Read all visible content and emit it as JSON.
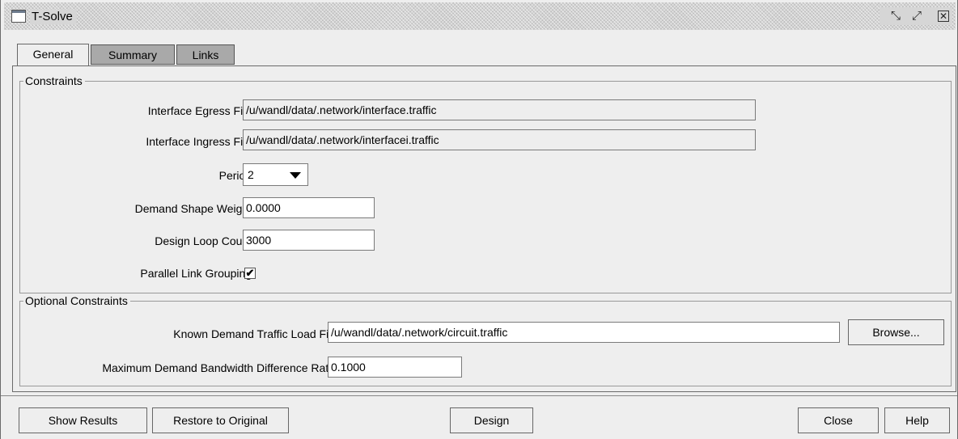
{
  "window": {
    "title": "T-Solve",
    "icon": "window-icon",
    "minimize_icon": "minimize-icon",
    "maximize_icon": "maximize-icon",
    "close_icon": "close-icon"
  },
  "tabs": [
    {
      "label": "General",
      "active": true
    },
    {
      "label": "Summary",
      "active": false
    },
    {
      "label": "Links",
      "active": false
    }
  ],
  "constraints": {
    "title": "Constraints",
    "egress_label": "Interface Egress File:",
    "egress_value": "/u/wandl/data/.network/interface.traffic",
    "ingress_label": "Interface Ingress File:",
    "ingress_value": "/u/wandl/data/.network/interfacei.traffic",
    "period_label": "Period:",
    "period_value": "2",
    "shape_weight_label": "Demand Shape Weight:",
    "shape_weight_value": "0.0000",
    "loop_count_label": "Design Loop Count:",
    "loop_count_value": "3000",
    "parallel_label": "Parallel Link Grouping:",
    "parallel_checked": true,
    "check_mark": "✔"
  },
  "optional": {
    "title": "Optional Constraints",
    "load_file_label": "Known Demand Traffic Load File:",
    "load_file_value": "/u/wandl/data/.network/circuit.traffic",
    "browse_label": "Browse...",
    "ratio_label": "Maximum Demand Bandwidth Difference Ratio:",
    "ratio_value": "0.1000"
  },
  "buttons": {
    "show_results": "Show Results",
    "restore": "Restore to Original",
    "design": "Design",
    "close": "Close",
    "help": "Help"
  }
}
